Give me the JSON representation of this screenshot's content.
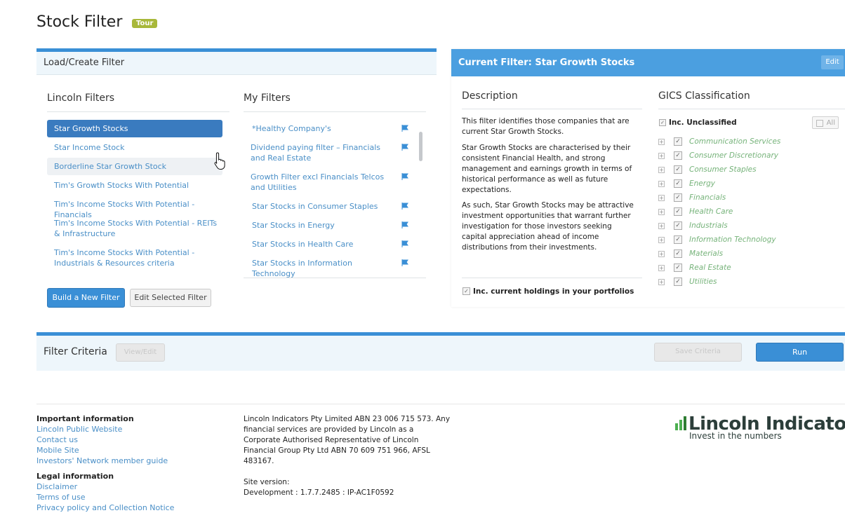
{
  "page": {
    "title": "Stock Filter",
    "tour_badge": "Tour"
  },
  "load_panel": {
    "header": "Load/Create Filter",
    "lincoln_title": "Lincoln Filters",
    "my_title": "My Filters",
    "lincoln_filters": [
      "Star Growth Stocks",
      "Star Income Stock",
      "Borderline Star Growth Stock",
      "Tim's Growth Stocks With Potential",
      "Tim's Income Stocks With Potential - Financials",
      "Tim's Income Stocks With Potential - REITs & Infrastructure",
      "Tim's Income Stocks With Potential - Industrials & Resources criteria"
    ],
    "my_filters": [
      "*Healthy Company's",
      "Dividend paying filter – Financials and Real Estate",
      "Growth Filter excl Financials Telcos and Utilities",
      "Star Stocks in Consumer Staples",
      "Star Stocks in Energy",
      "Star Stocks in Health Care",
      "Star Stocks in Information Technology"
    ],
    "build_button": "Build a New Filter",
    "edit_button": "Edit Selected Filter"
  },
  "current_filter": {
    "header": "Current Filter: Star Growth Stocks",
    "edit_label": "Edit",
    "description_title": "Description",
    "description": [
      "This filter identifies those companies that are current Star Growth Stocks.",
      "Star Growth Stocks are characterised by their consistent Financial Health, and strong management and earnings growth in terms of historical performance as well as future expectations.",
      "As such, Star Growth Stocks may be attractive investment opportunities that warrant further investigation for those investors seeking capital appreciation ahead of income distributions from their investments."
    ],
    "holdings_label": "Inc. current holdings in your portfolios",
    "gics_title": "GICS Classification",
    "unclassified_label": "Inc. Unclassified",
    "all_label": "All",
    "gics_sectors": [
      "Communication Services",
      "Consumer Discretionary",
      "Consumer Staples",
      "Energy",
      "Financials",
      "Health Care",
      "Industrials",
      "Information Technology",
      "Materials",
      "Real Estate",
      "Utilities"
    ]
  },
  "criteria": {
    "title": "Filter Criteria",
    "view_edit": "View/Edit",
    "save": "Save Criteria",
    "run": "Run"
  },
  "footer": {
    "important_heading": "Important information",
    "important_links": [
      "Lincoln Public Website",
      "Contact us",
      "Mobile Site",
      "Investors' Network member guide"
    ],
    "legal_heading": "Legal information",
    "legal_links": [
      "Disclaimer",
      "Terms of use",
      "Privacy policy and Collection Notice"
    ],
    "company_lines": [
      "Lincoln Indicators Pty Limited ABN 23 006 715 573. Any",
      "financial services are provided by Lincoln as a",
      "Corporate Authorised Representative of Lincoln",
      "Financial Group Pty Ltd ABN 70 609 751 966, AFSL",
      "483167."
    ],
    "site_version_label": "Site version:",
    "site_version": "Development : 1.7.7.2485 : IP-AC1F0592",
    "logo_name": "Lincoln Indicators",
    "logo_tagline": "Invest in the numbers"
  },
  "colors": {
    "accent": "#3a8fd6",
    "header_blue": "#4b9fe0",
    "gics_green": "#76b37a",
    "tour": "#a8b83a"
  }
}
